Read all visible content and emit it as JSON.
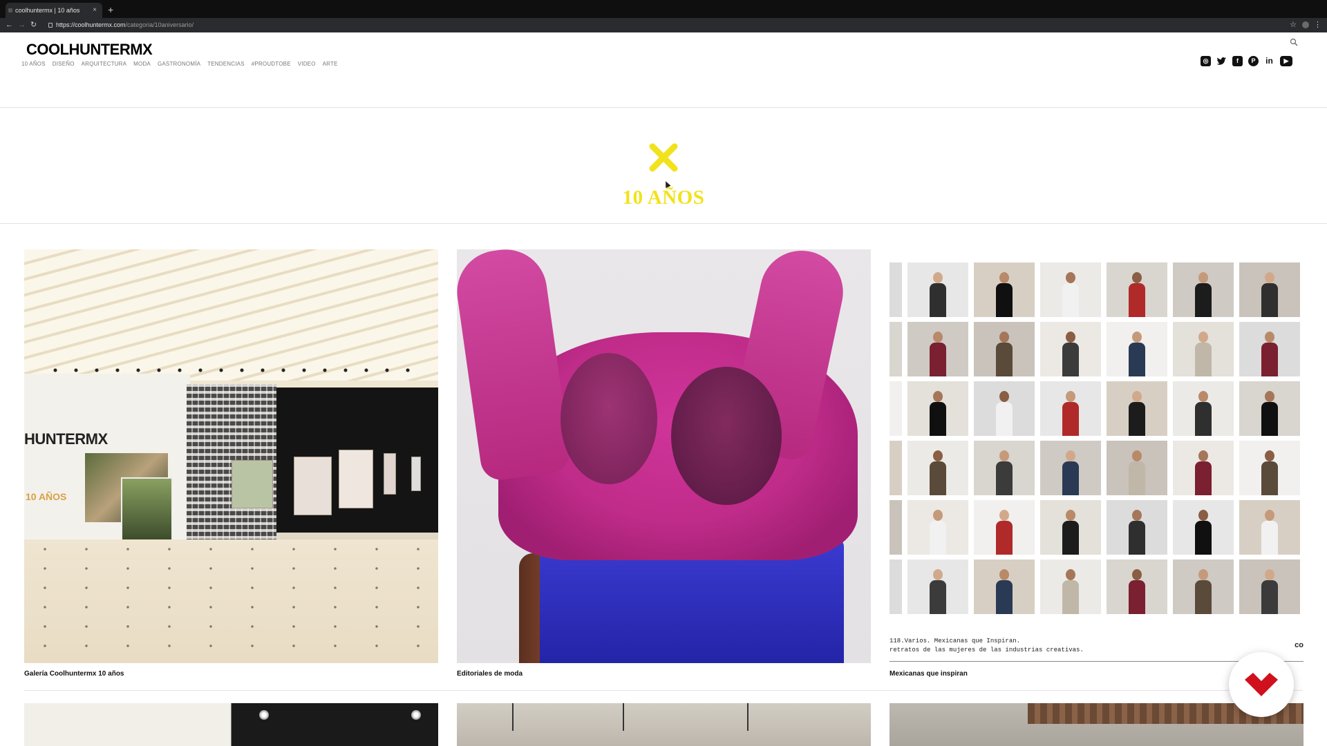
{
  "browser": {
    "tab_title": "coolhuntermx | 10 años",
    "tab_close": "×",
    "new_tab": "+",
    "url_host": "https://coolhuntermx.com",
    "url_path": "/categoria/10aniversario/",
    "back": "←",
    "forward": "→",
    "reload": "↻",
    "star": "☆",
    "menu": "⋮"
  },
  "header": {
    "logo": "COOLHUNTERMX",
    "nav": [
      "10 AÑOS",
      "DISEÑO",
      "ARQUITECTURA",
      "MODA",
      "GASTRONOMÍA",
      "TENDENCIAS",
      "#PROUDTOBE",
      "VIDEO",
      "ARTE"
    ],
    "social_icons": [
      "instagram-icon",
      "twitter-icon",
      "facebook-icon",
      "pinterest-icon",
      "linkedin-icon",
      "youtube-icon"
    ],
    "social_glyphs": [
      "◎",
      "🐦",
      "f",
      "P",
      "in",
      "▶"
    ]
  },
  "hero": {
    "title": "10 AÑOS",
    "accent_color": "#f2e21b"
  },
  "cards": [
    {
      "caption": "Galería Coolhuntermx 10 años",
      "image_text_1": "HUNTERMX",
      "image_text_2": "10 AÑOS"
    },
    {
      "caption": "Editoriales de moda"
    },
    {
      "caption": "Mexicanas que inspiran",
      "image_text_1": "118.Varios. Mexicanas que Inspiran.",
      "image_text_2": "retratos de las mujeres de las industrias creativas.",
      "image_text_3": "co"
    }
  ],
  "badge_color": "#d0101d"
}
